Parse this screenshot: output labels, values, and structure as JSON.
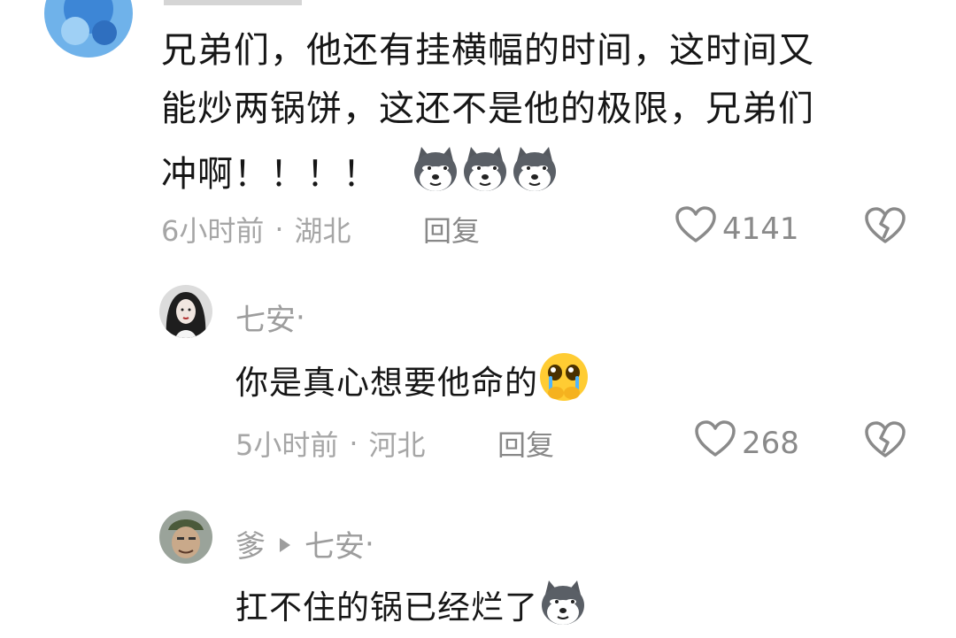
{
  "comment1": {
    "text_lines": [
      "兄弟们，他还有挂横幅的时间，这时间又",
      "能炒两锅饼，这还不是他的极限，兄弟们",
      "冲啊！！！！"
    ],
    "emoji_icons": [
      "doge-icon",
      "doge-icon",
      "doge-icon"
    ],
    "time": "6小时前",
    "location": "湖北",
    "reply_label": "回复",
    "likes": "4141"
  },
  "reply1": {
    "author": "七安",
    "text": "你是真心想要他命的",
    "emoji_icon": "pleading-face-icon",
    "time": "5小时前",
    "location": "河北",
    "reply_label": "回复",
    "likes": "268"
  },
  "reply2": {
    "author": "爹",
    "reply_to": "七安",
    "text": "扛不住的锅已经烂了",
    "emoji_icon": "doge-icon"
  },
  "colors": {
    "meta_gray": "#a6a6a6",
    "text": "#161616",
    "icon_gray": "#8a8a8a"
  }
}
